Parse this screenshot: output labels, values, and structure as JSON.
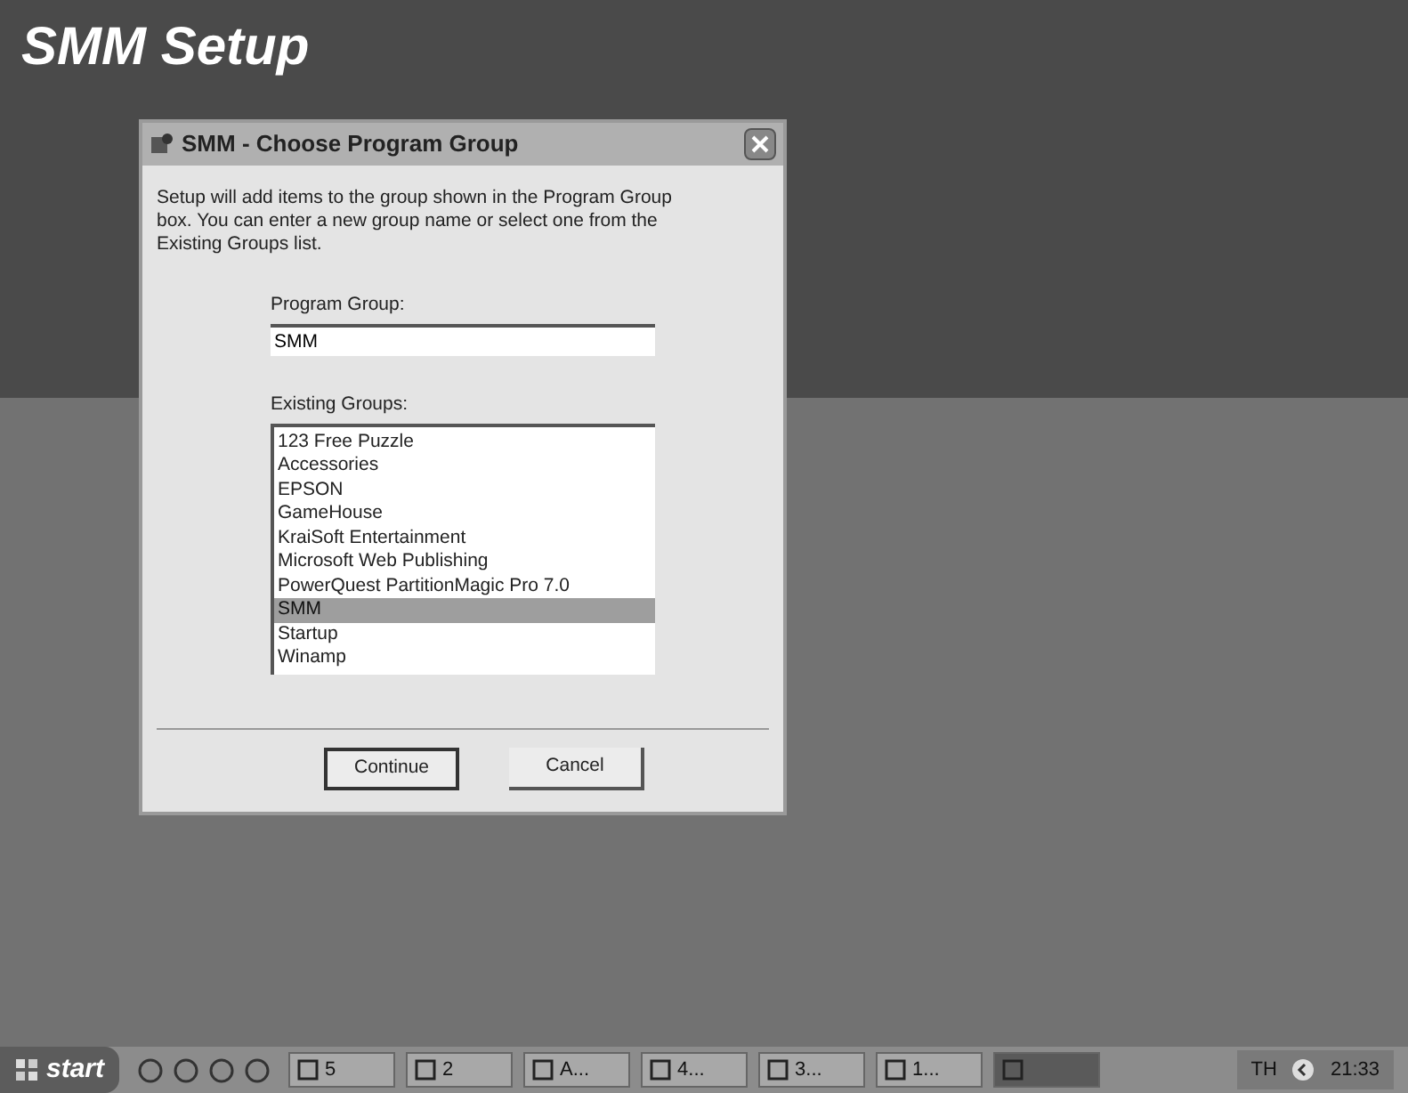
{
  "screen_title": "SMM Setup",
  "dialog": {
    "title": "SMM - Choose Program Group",
    "message": "Setup will add items to the group shown in the Program Group box. You can enter a new group name or select one from the Existing Groups list.",
    "program_group": {
      "label": "Program Group:",
      "value": "SMM"
    },
    "existing_groups": {
      "label": "Existing Groups:",
      "items": [
        {
          "label": "123 Free Puzzle",
          "selected": false
        },
        {
          "label": "Accessories",
          "selected": false
        },
        {
          "label": "EPSON",
          "selected": false
        },
        {
          "label": "GameHouse",
          "selected": false
        },
        {
          "label": "KraiSoft Entertainment",
          "selected": false
        },
        {
          "label": "Microsoft Web Publishing",
          "selected": false
        },
        {
          "label": "PowerQuest PartitionMagic Pro 7.0",
          "selected": false
        },
        {
          "label": "SMM",
          "selected": true
        },
        {
          "label": "Startup",
          "selected": false
        },
        {
          "label": "Winamp",
          "selected": false
        }
      ]
    },
    "buttons": [
      {
        "label": "Continue",
        "default": true
      },
      {
        "label": "Cancel",
        "default": false
      }
    ]
  },
  "taskbar": {
    "start": "start",
    "tasks": [
      {
        "label": "5",
        "selected": false
      },
      {
        "label": "2",
        "selected": false
      },
      {
        "label": "A...",
        "selected": false
      },
      {
        "label": "4...",
        "selected": false
      },
      {
        "label": "3...",
        "selected": false
      },
      {
        "label": "1...",
        "selected": false
      },
      {
        "selected": true
      }
    ],
    "language": "TH",
    "clock": "21:33"
  }
}
